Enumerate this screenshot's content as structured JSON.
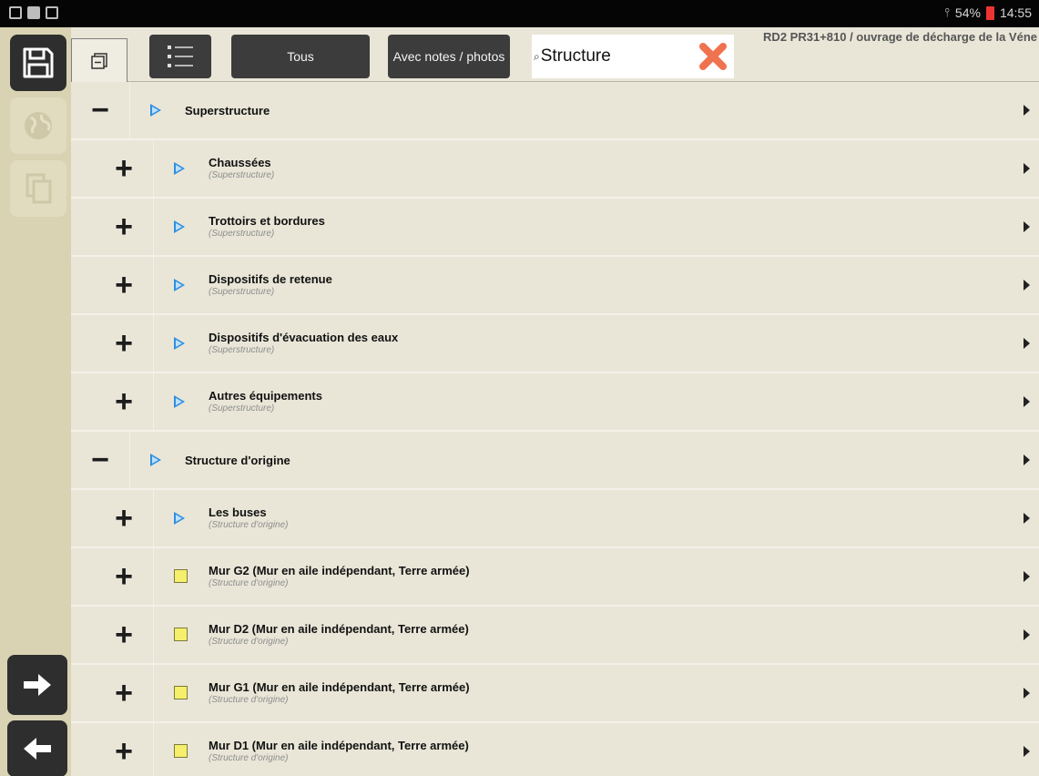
{
  "status_bar": {
    "battery": "54%",
    "time": "14:55"
  },
  "toolbar": {
    "btn_all": "Tous",
    "btn_notes": "Avec notes / photos",
    "search_value": "Structure",
    "site_title": "RD2 PR31+810 / ouvrage de décharge de la Véne"
  },
  "tree": [
    {
      "level": 1,
      "sign": "−",
      "marker": "play",
      "label": "Superstructure"
    },
    {
      "level": 2,
      "sign": "+",
      "marker": "play",
      "label": "Chaussées",
      "sub": "(Superstructure)"
    },
    {
      "level": 2,
      "sign": "+",
      "marker": "play",
      "label": "Trottoirs et bordures",
      "sub": "(Superstructure)"
    },
    {
      "level": 2,
      "sign": "+",
      "marker": "play",
      "label": "Dispositifs de retenue",
      "sub": "(Superstructure)"
    },
    {
      "level": 2,
      "sign": "+",
      "marker": "play",
      "label": "Dispositifs d'évacuation des eaux",
      "sub": "(Superstructure)"
    },
    {
      "level": 2,
      "sign": "+",
      "marker": "play",
      "label": "Autres équipements",
      "sub": "(Superstructure)"
    },
    {
      "level": 1,
      "sign": "−",
      "marker": "play",
      "label": "Structure d'origine"
    },
    {
      "level": 2,
      "sign": "+",
      "marker": "play",
      "label": "Les buses",
      "sub": "(Structure d'origine)"
    },
    {
      "level": 2,
      "sign": "+",
      "marker": "square",
      "label": "Mur G2 (Mur en aile indépendant, Terre armée)",
      "sub": "(Structure d'origine)"
    },
    {
      "level": 2,
      "sign": "+",
      "marker": "square",
      "label": "Mur D2 (Mur en aile indépendant, Terre armée)",
      "sub": "(Structure d'origine)"
    },
    {
      "level": 2,
      "sign": "+",
      "marker": "square",
      "label": "Mur G1 (Mur en aile indépendant, Terre armée)",
      "sub": "(Structure d'origine)"
    },
    {
      "level": 2,
      "sign": "+",
      "marker": "square",
      "label": "Mur D1 (Mur en aile indépendant, Terre armée)",
      "sub": "(Structure d'origine)"
    }
  ],
  "colors": {
    "background": "#e9e6d8",
    "sidebar": "#d9d3b3",
    "dark_button": "#3c3c3c",
    "play_blue": "#2f8fe0",
    "square_yellow": "#f6ef6b",
    "clear_red": "#f0734f"
  },
  "icons": {
    "save": "floppy-disk-icon",
    "globe": "globe-icon",
    "copy": "copy-icon",
    "next": "arrow-right-icon",
    "prev": "arrow-left-icon",
    "collapse": "collapse-all-icon",
    "list": "list-icon",
    "search": "search-icon",
    "clear": "clear-x-icon"
  }
}
